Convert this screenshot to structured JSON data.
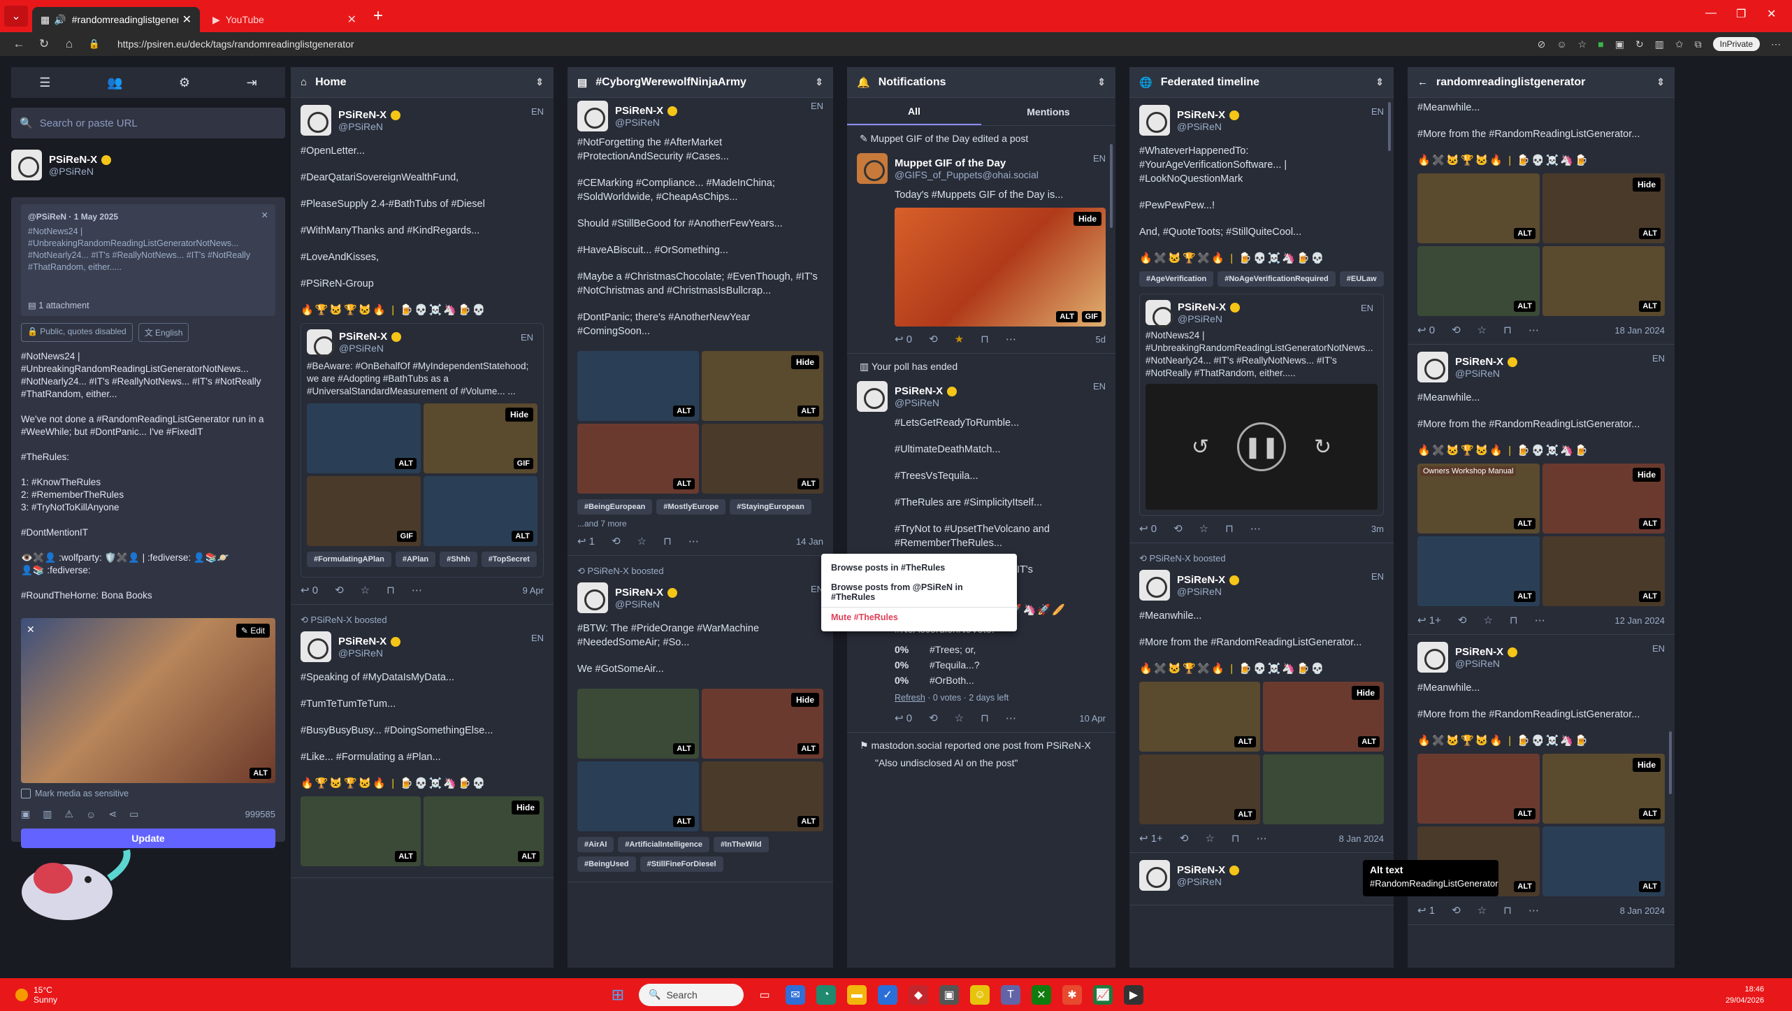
{
  "browser": {
    "tabs": [
      {
        "label": "#randomreadinglistgenerator",
        "active": true
      },
      {
        "label": "YouTube",
        "active": false
      }
    ],
    "url": "https://psiren.eu/deck/tags/randomreadinglistgenerator",
    "inprivate": "InPrivate"
  },
  "sidebar": {
    "search_placeholder": "Search or paste URL",
    "account": {
      "name": "PSiReN-X",
      "handle": "@PSiReN"
    },
    "reply": {
      "meta": "@PSiReN · 1 May 2025",
      "text": "#NotNews24 | #UnbreakingRandomReadingListGeneratorNotNews... #NotNearly24... #IT's #ReallyNotNews... #IT's #NotReally #ThatRandom, either.....",
      "attachment": "1 attachment"
    },
    "chips": {
      "visibility": "Public, quotes disabled",
      "language": "English"
    },
    "compose_text": "#NotNews24 |\n#UnbreakingRandomReadingListGeneratorNotNews... #NotNearly24... #IT's #ReallyNotNews... #IT's #NotReally #ThatRandom, either...\n\nWe've not done a #RandomReadingListGenerator run in a #WeeWhile; but #DontPanic... I've #FixedIT\n\n#TheRules:\n\n1: #KnowTheRules\n2: #RememberTheRules\n3: #TryNotToKillAnyone\n\n#DontMentionIT\n\n👁️✖️👤 :wolfparty: 🛡️✖️👤 | :fediverse: 👤📚🪐\n👤📚 :fediverse:\n\n#RoundTheHorne: Bona Books",
    "edit_label": "Edit",
    "alt_label": "ALT",
    "sensitive_label": "Mark media as sensitive",
    "char_count": "999585",
    "update_label": "Update"
  },
  "columns": {
    "home": {
      "title": "Home",
      "posts": [
        {
          "name": "PSiReN-X",
          "handle": "@PSiReN",
          "lang": "EN",
          "lines": [
            "#OpenLetter...",
            "#DearQatariSovereignWealthFund,",
            "#PleaseSupply 2.4-#BathTubs of #Diesel",
            "#WithManyThanks and #KindRegards...",
            "#LoveAndKisses,",
            "#PSiReN-Group"
          ],
          "emoji": "🔥🏆🐱🏆🐱🔥 | 🍺💀☠️🦄🍺💀"
        },
        {
          "name": "PSiReN-X",
          "handle": "@PSiReN",
          "lang": "EN",
          "lines": [
            "#BeAware: #OnBehalfOf #MyIndependentStatehood; we are #Adopting #BathTubs as a #UniversalStandardMeasurement of #Volume... ..."
          ],
          "tags": [
            "#FormulatingAPlan",
            "#APlan",
            "#Shhh",
            "#TopSecret"
          ],
          "date": "9 Apr",
          "alt": "ALT",
          "gif": "GIF",
          "hide": "Hide"
        },
        {
          "boost": "PSiReN-X boosted",
          "name": "PSiReN-X",
          "handle": "@PSiReN",
          "lang": "EN",
          "lines": [
            "#Speaking of #MyDataIsMyData...",
            "#TumTeTumTeTum...",
            "#BusyBusyBusy... #DoingSomethingElse...",
            "#Like... #Formulating a #Plan..."
          ],
          "emoji": "🔥🏆🐱🏆🐱🔥 | 🍺💀☠️🦄🍺💀"
        }
      ]
    },
    "cyborg": {
      "title": "#CyborgWerewolfNinjaArmy",
      "posts": [
        {
          "name": "PSiReN-X",
          "handle": "@PSiReN",
          "lang": "EN",
          "lines": [
            "#NotForgetting the #AfterMarket #ProtectionAndSecurity #Cases...",
            "#CEMarking #Compliance... #MadeInChina; #SoldWorldwide, #CheapAsChips...",
            "Should #StillBeGood for #AnotherFewYears...",
            "#HaveABiscuit... #OrSomething...",
            "#Maybe a #ChristmasChocolate; #EvenThough, #IT's #NotChristmas and #ChristmasIsBullcrap...",
            "#DontPanic; there's #AnotherNewYear #ComingSoon..."
          ],
          "tags": [
            "#BeingEuropean",
            "#MostlyEurope",
            "#StayingEuropean"
          ],
          "more": "...and 7 more",
          "date": "14 Jan"
        },
        {
          "boost": "PSiReN-X boosted",
          "name": "PSiReN-X",
          "handle": "@PSiReN",
          "lang": "EN",
          "lines": [
            "#BTW: The #PrideOrange #WarMachine #NeededSomeAir; #So...",
            "We #GotSomeAir..."
          ],
          "tags": [
            "#AirAI",
            "#ArtificialIntelligence",
            "#InTheWild",
            "#BeingUsed",
            "#StillFineForDiesel"
          ]
        }
      ]
    },
    "notifications": {
      "title": "Notifications",
      "tabs": [
        "All",
        "Mentions"
      ],
      "edited": "Muppet GIF of the Day edited a post",
      "muppet": {
        "name": "Muppet GIF of the Day",
        "handle": "@GIFS_of_Puppets@ohai.social",
        "lang": "EN",
        "text": "Today's #Muppets GIF of the Day is...",
        "date": "5d",
        "count": "0"
      },
      "poll_ended": "Your poll has ended",
      "poll_post": {
        "name": "PSiReN-X",
        "handle": "@PSiReN",
        "lang": "EN",
        "lines": [
          "#LetsGetReadyToRumble...",
          "#UltimateDeathMatch...",
          "#TreesVsTequila...",
          "#TheRules are #SimplicityItself...",
          "#TryNot to #UpsetTheVolcano and #RememberTheRules...",
          "And, 4: #StopBeingHitler; #IT's #TheNewRules..."
        ],
        "q": "#NoAccordionNoVote:",
        "options": [
          {
            "pct": "0%",
            "label": "#Trees; or,"
          },
          {
            "pct": "0%",
            "label": "#Tequila...?"
          },
          {
            "pct": "0%",
            "label": "#OrBoth..."
          }
        ],
        "refresh": "Refresh",
        "votes": " · 0 votes · 2 days left",
        "date": "10 Apr"
      },
      "report": "mastodon.social reported one post from PSiReN-X",
      "report_quote": "\"Also undisclosed AI on the post\""
    },
    "federated": {
      "title": "Federated timeline",
      "posts": [
        {
          "name": "PSiReN-X",
          "handle": "@PSiReN",
          "lang": "EN",
          "lines": [
            "#WhateverHappenedTo: #YourAgeVerificationSoftware... | #LookNoQuestionMark",
            "#PewPewPew...!",
            "And, #QuoteToots; #StillQuiteCool..."
          ],
          "tags": [
            "#AgeVerification",
            "#NoAgeVerificationRequired",
            "#EULaw"
          ],
          "quote": {
            "name": "PSiReN-X",
            "handle": "@PSiReN",
            "lang": "EN",
            "text": "#NotNews24 | #UnbreakingRandomReadingListGeneratorNotNews... #NotNearly24... #IT's #ReallyNotNews... #IT's #NotReally #ThatRandom, either....."
          },
          "date": "3m"
        },
        {
          "boost": "PSiReN-X boosted",
          "name": "PSiReN-X",
          "handle": "@PSiReN",
          "lang": "EN",
          "lines": [
            "#Meanwhile...",
            "#More from the #RandomReadingListGenerator..."
          ],
          "date": "8 Jan 2024"
        },
        {
          "name": "PSiReN-X",
          "handle": "@PSiReN",
          "lang": "EN"
        }
      ]
    },
    "rrlg": {
      "title": "randomreadinglistgenerator",
      "posts": [
        {
          "lines": [
            "#Meanwhile...",
            "#More from the #RandomReadingListGenerator..."
          ],
          "date": "18 Jan 2024"
        },
        {
          "name": "PSiReN-X",
          "handle": "@PSiReN",
          "lang": "EN",
          "lines": [
            "#Meanwhile...",
            "#More from the #RandomReadingListGenerator..."
          ],
          "date": "12 Jan 2024",
          "count": "1+",
          "media_label": "Owners Workshop Manual"
        },
        {
          "name": "PSiReN-X",
          "handle": "@PSiReN",
          "lang": "EN",
          "lines": [
            "#Meanwhile...",
            "#More from the #RandomReadingListGenerator..."
          ],
          "date": "8 Jan 2024",
          "count": "1"
        }
      ]
    }
  },
  "popup": {
    "items": [
      "Browse posts in #TheRules",
      "Browse posts from @PSiReN in #TheRules",
      "Mute #TheRules"
    ]
  },
  "alt_tooltip": {
    "title": "Alt text",
    "value": "#RandomReadingListGenerator"
  },
  "taskbar": {
    "temp": "15°C",
    "cond": "Sunny",
    "search": "Search",
    "time": "18:46",
    "date": "29/04/2026"
  }
}
